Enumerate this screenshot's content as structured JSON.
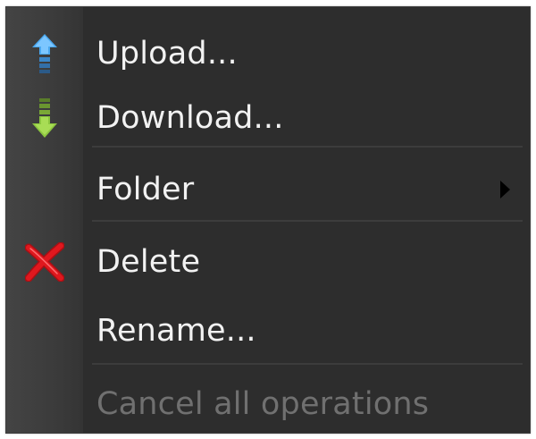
{
  "menu": {
    "items": [
      {
        "label": "Upload...",
        "icon": "upload-arrow-icon"
      },
      {
        "label": "Download...",
        "icon": "download-arrow-icon"
      },
      {
        "label": "Folder",
        "submenu": true
      },
      {
        "label": "Delete",
        "icon": "red-x-delete-icon"
      },
      {
        "label": "Rename..."
      },
      {
        "label": "Cancel all operations",
        "disabled": true
      }
    ]
  },
  "colors": {
    "menu_background": "#2d2d2d",
    "gutter_background": "#3c3c3c",
    "text": "#f2f2f2",
    "disabled_text": "#707070",
    "upload_icon": "#4aa8f0",
    "download_icon": "#8cc63f",
    "delete_icon": "#e0181e"
  }
}
